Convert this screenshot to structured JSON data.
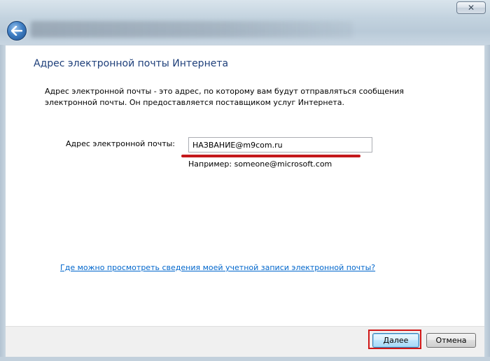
{
  "window": {
    "close_symbol": "✕"
  },
  "icons": {
    "back": "back-arrow-icon",
    "close": "close-icon"
  },
  "page": {
    "heading": "Адрес электронной почты Интернета",
    "description": "Адрес электронной почты - это адрес, по которому вам будут отправляться сообщения электронной почты. Он предоставляется поставщиком услуг Интернета."
  },
  "form": {
    "email_label": "Адрес электронной почты:",
    "email_value": "НАЗВАНИЕ@m9com.ru",
    "example": "Например: someone@microsoft.com"
  },
  "help_link": "Где можно просмотреть сведения моей учетной записи электронной почты?",
  "buttons": {
    "next": "Далее",
    "cancel": "Отмена"
  },
  "colors": {
    "heading": "#1e3f7a",
    "link": "#0066cc",
    "annotation_red": "#c4181b"
  }
}
